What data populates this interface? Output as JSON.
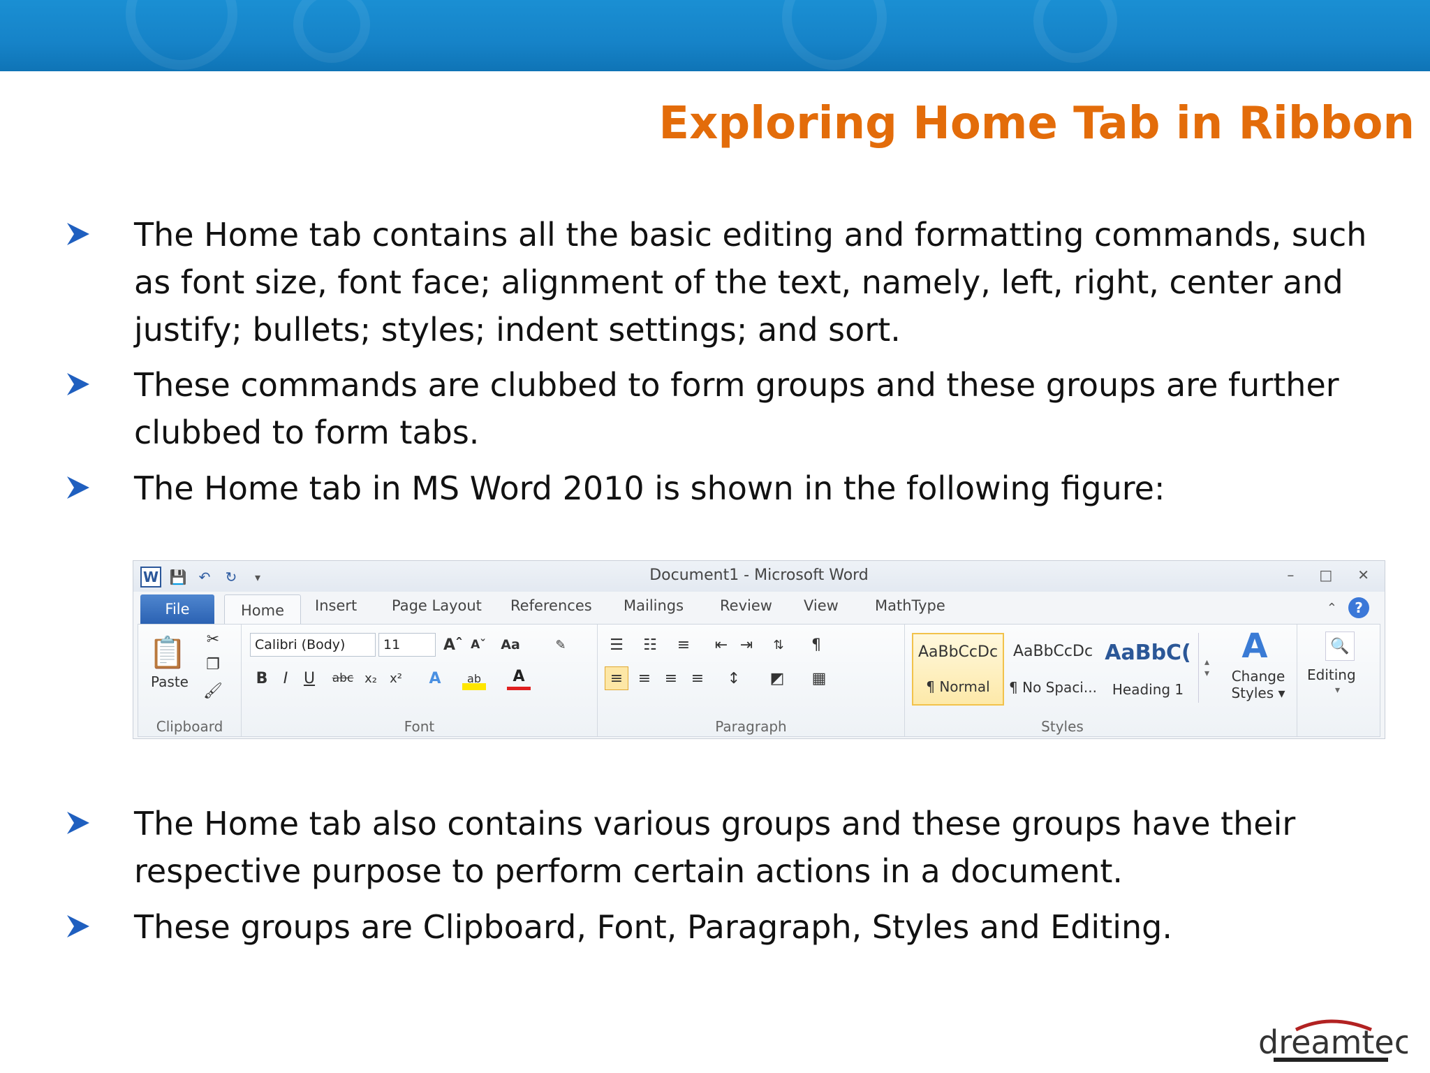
{
  "slide": {
    "title": "Exploring Home Tab in Ribbon",
    "bullets": [
      "The Home tab contains all the basic editing and formatting commands, such",
      "as font size, font face; alignment of the text, namely, left, right, center and",
      "justify; bullets; styles; indent settings; and sort.",
      "These commands are clubbed to form groups and these groups are further",
      "clubbed to form tabs.",
      "The Home tab in MS Word 2010 is shown in the following figure:",
      "The Home tab also contains various groups and these groups have their",
      "respective purpose to perform certain actions in a document.",
      "These groups are Clipboard, Font, Paragraph, Styles and Editing."
    ],
    "logo_text": "dreamtech",
    "colors": {
      "title": "#e36c0a",
      "banner": "#1683c8",
      "arrow": "#1f5fbf"
    }
  },
  "ribbon": {
    "window_title": "Document1  -  Microsoft Word",
    "word_icon": "W",
    "tabs": [
      "File",
      "Home",
      "Insert",
      "Page Layout",
      "References",
      "Mailings",
      "Review",
      "View",
      "MathType"
    ],
    "clipboard": {
      "paste": "Paste",
      "label": "Clipboard"
    },
    "font": {
      "name": "Calibri (Body)",
      "size": "11",
      "label": "Font"
    },
    "paragraph": {
      "label": "Paragraph"
    },
    "styles": {
      "label": "Styles",
      "items": [
        {
          "sample": "AaBbCcDc",
          "name": "¶ Normal"
        },
        {
          "sample": "AaBbCcDc",
          "name": "¶ No Spaci..."
        },
        {
          "sample": "AaBbC(",
          "name": "Heading 1"
        }
      ],
      "change_styles_line1": "Change",
      "change_styles_line2": "Styles ▾"
    },
    "editing": {
      "label": "Editing"
    }
  }
}
